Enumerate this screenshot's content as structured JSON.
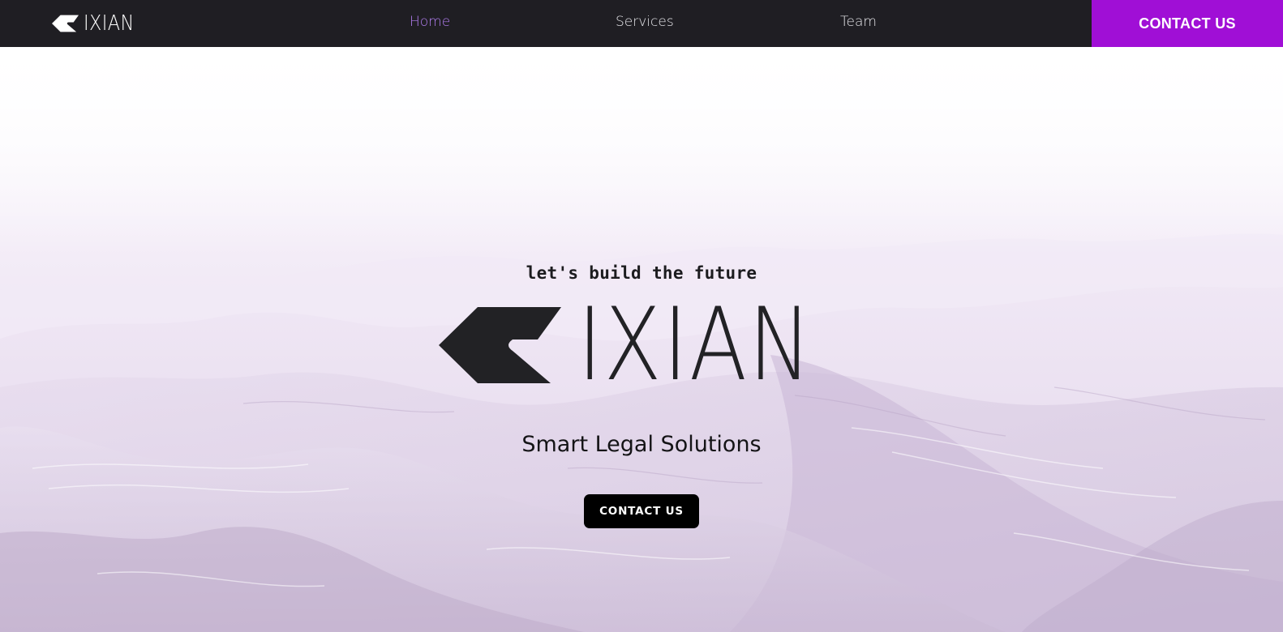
{
  "brand": {
    "name": "IXIAN",
    "logo_icon": "ixian-arrow-mark-icon"
  },
  "nav": {
    "items": [
      {
        "label": "Home",
        "active": true
      },
      {
        "label": "Services",
        "active": false
      },
      {
        "label": "Team",
        "active": false
      }
    ],
    "cta_label": "CONTACT US"
  },
  "hero": {
    "tagline": "let's build the future",
    "logo_text": "IXIAN",
    "subtitle": "Smart Legal Solutions",
    "cta_label": "CONTACT US",
    "background": "lavender-sand-dunes"
  },
  "colors": {
    "nav_background": "#1f1e23",
    "accent_purple": "#a00fd6",
    "active_link": "#b27ef0",
    "hero_tint": "#ece3f2",
    "button_black": "#000000"
  }
}
